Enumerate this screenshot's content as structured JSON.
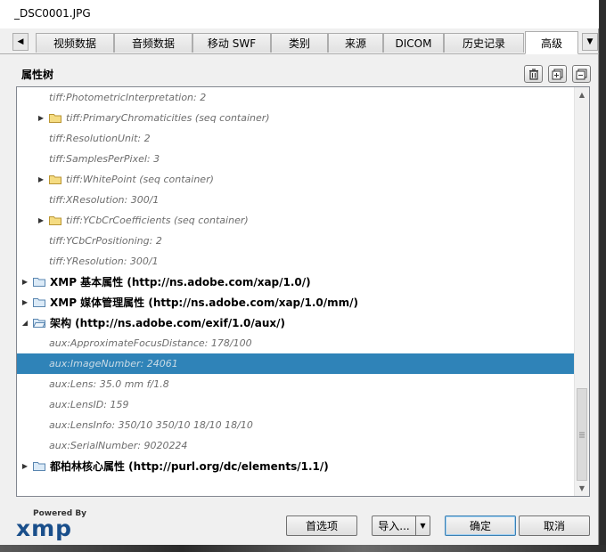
{
  "window": {
    "title": "_DSC0001.JPG"
  },
  "tabs": [
    {
      "label": "视频数据"
    },
    {
      "label": "音频数据"
    },
    {
      "label": "移动 SWF"
    },
    {
      "label": "类别"
    },
    {
      "label": "来源"
    },
    {
      "label": "DICOM"
    },
    {
      "label": "历史记录"
    },
    {
      "label": "高级"
    }
  ],
  "panel": {
    "title": "属性树"
  },
  "tree": {
    "rows": [
      {
        "text": "tiff:PhotometricInterpretation: 2"
      },
      {
        "text": "tiff:PrimaryChromaticities (seq container)"
      },
      {
        "text": "tiff:ResolutionUnit: 2"
      },
      {
        "text": "tiff:SamplesPerPixel: 3"
      },
      {
        "text": "tiff:WhitePoint (seq container)"
      },
      {
        "text": "tiff:XResolution: 300/1"
      },
      {
        "text": "tiff:YCbCrCoefficients (seq container)"
      },
      {
        "text": "tiff:YCbCrPositioning: 2"
      },
      {
        "text": "tiff:YResolution: 300/1"
      },
      {
        "text": "XMP 基本属性 (http://ns.adobe.com/xap/1.0/)"
      },
      {
        "text": "XMP 媒体管理属性 (http://ns.adobe.com/xap/1.0/mm/)"
      },
      {
        "text": "架构 (http://ns.adobe.com/exif/1.0/aux/)"
      },
      {
        "text": "aux:ApproximateFocusDistance: 178/100"
      },
      {
        "text": "aux:ImageNumber: 24061"
      },
      {
        "text": "aux:Lens: 35.0 mm f/1.8"
      },
      {
        "text": "aux:LensID: 159"
      },
      {
        "text": "aux:LensInfo: 350/10 350/10 18/10 18/10"
      },
      {
        "text": "aux:SerialNumber: 9020224"
      },
      {
        "text": "都柏林核心属性 (http://purl.org/dc/elements/1.1/)"
      }
    ]
  },
  "logo": {
    "powered_by": "Powered By",
    "brand": "xmp"
  },
  "buttons": {
    "preferences": "首选项",
    "import": "导入...",
    "ok": "确定",
    "cancel": "取消"
  },
  "colors": {
    "selection": "#2f83b8",
    "folder": "#f5dc82",
    "xmp_brand": "#1a4f8b"
  }
}
